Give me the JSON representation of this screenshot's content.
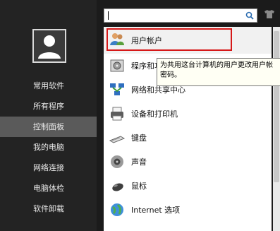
{
  "sidebar": {
    "items": [
      {
        "label": "常用软件"
      },
      {
        "label": "所有程序"
      },
      {
        "label": "控制面板"
      },
      {
        "label": "我的电脑"
      },
      {
        "label": "网络连接"
      },
      {
        "label": "电脑体检"
      },
      {
        "label": "软件卸载"
      }
    ],
    "selected_index": 2
  },
  "search": {
    "value": "",
    "placeholder": ""
  },
  "list": {
    "items": [
      {
        "label": "用户帐户",
        "icon": "users-icon"
      },
      {
        "label": "程序和功能",
        "icon": "programs-icon"
      },
      {
        "label": "网络和共享中心",
        "icon": "network-icon"
      },
      {
        "label": "设备和打印机",
        "icon": "printer-icon"
      },
      {
        "label": "键盘",
        "icon": "keyboard-icon"
      },
      {
        "label": "声音",
        "icon": "speaker-icon"
      },
      {
        "label": "鼠标",
        "icon": "mouse-icon"
      },
      {
        "label": "Internet 选项",
        "icon": "globe-icon"
      }
    ]
  },
  "tooltip": {
    "line1": "为共用这台计算机的用户更改用户帐",
    "line2": "密码。"
  },
  "colors": {
    "highlight": "#d61818",
    "selected": "#5a5a5a"
  }
}
